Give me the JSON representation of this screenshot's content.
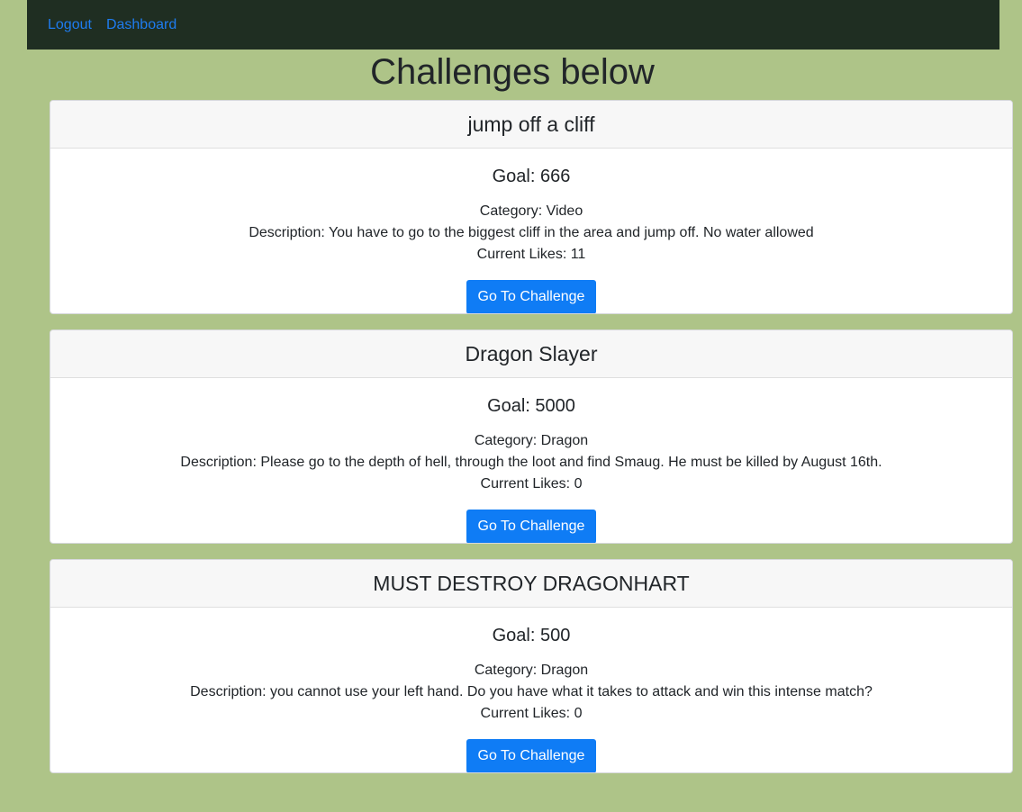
{
  "nav": {
    "links": [
      "Logout",
      "Dashboard"
    ]
  },
  "page": {
    "title": "Challenges below"
  },
  "challenges": [
    {
      "title": "jump off a cliff",
      "goal": "Goal: 666",
      "category": "Category: Video",
      "description": "Description: You have to go to the biggest cliff in the area and jump off. No water allowed",
      "likes": "Current Likes: 11",
      "button": "Go To Challenge"
    },
    {
      "title": "Dragon Slayer",
      "goal": "Goal: 5000",
      "category": "Category: Dragon",
      "description": "Description: Please go to the depth of hell, through the loot and find Smaug. He must be killed by August 16th.",
      "likes": "Current Likes: 0",
      "button": "Go To Challenge"
    },
    {
      "title": "MUST DESTROY DRAGONHART",
      "goal": "Goal: 500",
      "category": "Category: Dragon",
      "description": "Description: you cannot use your left hand. Do you have what it takes to attack and win this intense match?",
      "likes": "Current Likes: 0",
      "button": "Go To Challenge"
    }
  ],
  "colors": {
    "background": "#aec488",
    "navbar": "#1f2e22",
    "link": "#1e7cf0",
    "button": "#0f7cf5"
  }
}
